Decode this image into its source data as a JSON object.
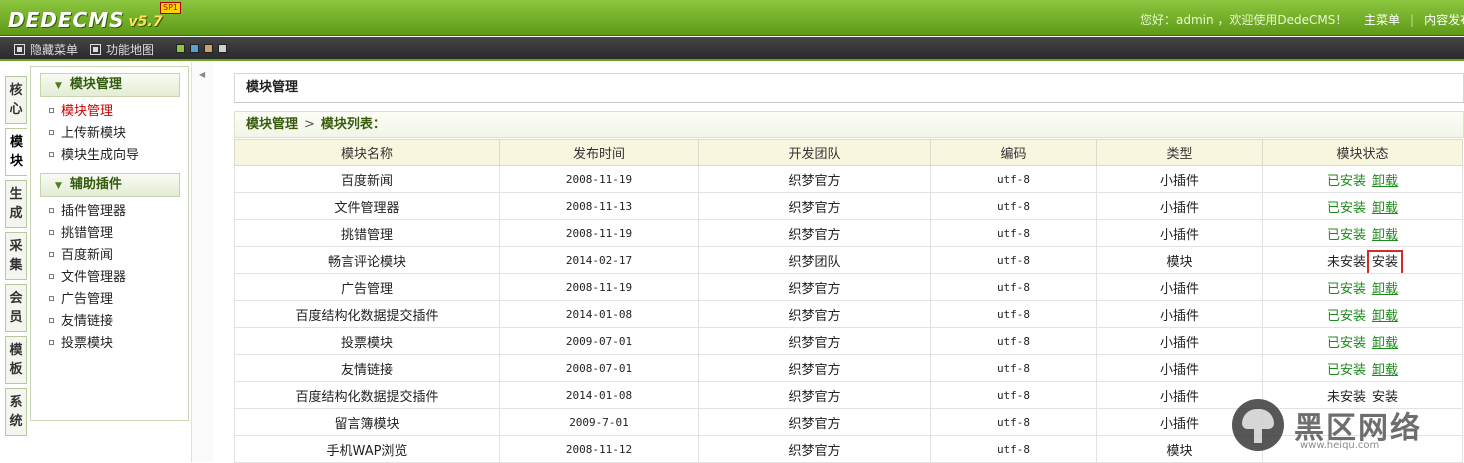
{
  "header": {
    "logo_text": "DEDECMS",
    "version": "v5.7",
    "edition_badge": "SP1",
    "welcome": "您好：admin ，欢迎使用DedeCMS！",
    "links": [
      "主菜单",
      "内容发布"
    ]
  },
  "menubar": {
    "hide_menu": "隐藏菜单",
    "func_map": "功能地图",
    "skin_colors": [
      "#8cc63f",
      "#57a0d8",
      "#c9a36b",
      "#d0d0d0"
    ]
  },
  "left_tabs": [
    "核心",
    "模块",
    "生成",
    "采集",
    "会员",
    "模板",
    "系统"
  ],
  "active_tab": "模块",
  "sidebar": {
    "groups": [
      {
        "title": "模块管理",
        "items": [
          "模块管理",
          "上传新模块",
          "模块生成向导"
        ]
      },
      {
        "title": "辅助插件",
        "items": [
          "插件管理器",
          "挑错管理",
          "百度新闻",
          "文件管理器",
          "广告管理",
          "友情链接",
          "投票模块"
        ]
      }
    ],
    "active_item": "模块管理"
  },
  "main": {
    "title": "模块管理",
    "breadcrumb": [
      "模块管理",
      "模块列表："
    ],
    "columns": [
      "模块名称",
      "发布时间",
      "开发团队",
      "编码",
      "类型",
      "模块状态"
    ],
    "rows": [
      {
        "name": "百度新闻",
        "date": "2008-11-19",
        "team": "织梦官方",
        "enc": "utf-8",
        "type": "小插件",
        "status": "已安装",
        "action": "卸载"
      },
      {
        "name": "文件管理器",
        "date": "2008-11-13",
        "team": "织梦官方",
        "enc": "utf-8",
        "type": "小插件",
        "status": "已安装",
        "action": "卸载"
      },
      {
        "name": "挑错管理",
        "date": "2008-11-19",
        "team": "织梦官方",
        "enc": "utf-8",
        "type": "小插件",
        "status": "已安装",
        "action": "卸载"
      },
      {
        "name": "畅言评论模块",
        "date": "2014-02-17",
        "team": "织梦团队",
        "enc": "utf-8",
        "type": "模块",
        "status": "未安装",
        "action": "安装"
      },
      {
        "name": "广告管理",
        "date": "2008-11-19",
        "team": "织梦官方",
        "enc": "utf-8",
        "type": "小插件",
        "status": "已安装",
        "action": "卸载"
      },
      {
        "name": "百度结构化数据提交插件",
        "date": "2014-01-08",
        "team": "织梦官方",
        "enc": "utf-8",
        "type": "小插件",
        "status": "已安装",
        "action": "卸载"
      },
      {
        "name": "投票模块",
        "date": "2009-07-01",
        "team": "织梦官方",
        "enc": "utf-8",
        "type": "小插件",
        "status": "已安装",
        "action": "卸载"
      },
      {
        "name": "友情链接",
        "date": "2008-07-01",
        "team": "织梦官方",
        "enc": "utf-8",
        "type": "小插件",
        "status": "已安装",
        "action": "卸载"
      },
      {
        "name": "百度结构化数据提交插件",
        "date": "2014-01-08",
        "team": "织梦官方",
        "enc": "utf-8",
        "type": "小插件",
        "status": "未安装",
        "action": "安装"
      },
      {
        "name": "留言簿模块",
        "date": "2009-7-01",
        "team": "织梦官方",
        "enc": "utf-8",
        "type": "小插件",
        "status": "",
        "action": ""
      },
      {
        "name": "手机WAP浏览",
        "date": "2008-11-12",
        "team": "织梦官方",
        "enc": "utf-8",
        "type": "模块",
        "status": "",
        "action": ""
      }
    ],
    "highlighted_row_index": 3
  },
  "watermark": {
    "text": "黑区网络",
    "url": "www.heiqu.com"
  }
}
